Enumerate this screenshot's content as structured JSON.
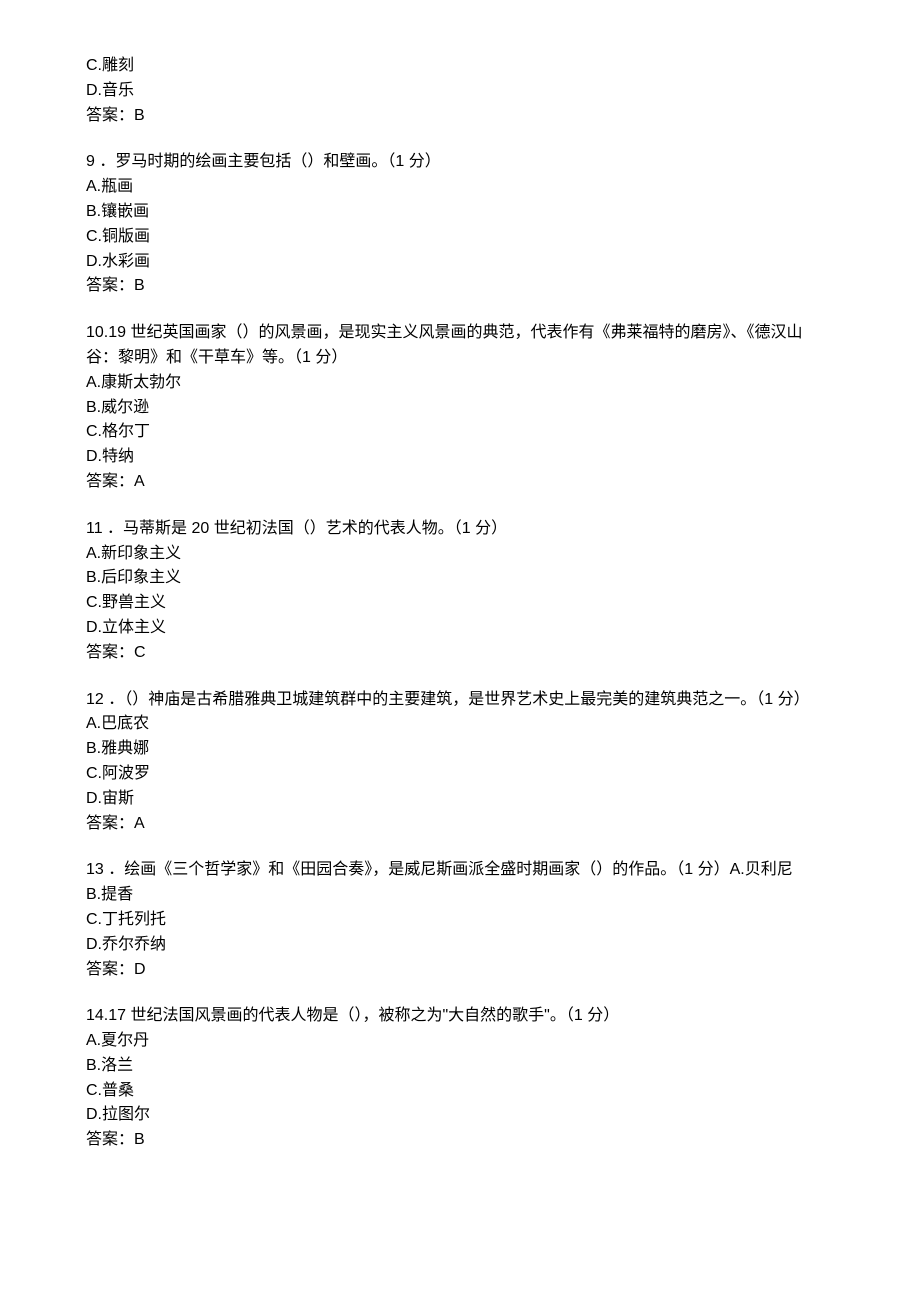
{
  "questions": [
    {
      "stem": "",
      "optC": "C.雕刻",
      "optD": "D.音乐",
      "answer": "答案：B"
    },
    {
      "stem": "9 ．罗马时期的绘画主要包括（）和壁画。（1 分）",
      "optA": "A.瓶画",
      "optB": "B.镶嵌画",
      "optC": "C.铜版画",
      "optD": "D.水彩画",
      "answer": "答案：B"
    },
    {
      "stem": "10.19 世纪英国画家（）的风景画，是现实主义风景画的典范，代表作有《弗莱福特的磨房》、《德汉山谷：黎明》和《干草车》等。（1 分）",
      "optA": "A.康斯太勃尔",
      "optB": "B.威尔逊",
      "optC": "C.格尔丁",
      "optD": "D.特纳",
      "answer": "答案：A"
    },
    {
      "stem": "11 ．马蒂斯是 20 世纪初法国（）艺术的代表人物。（1 分）",
      "optA": "A.新印象主义",
      "optB": "B.后印象主义",
      "optC": "C.野兽主义",
      "optD": "D.立体主义",
      "answer": "答案：C"
    },
    {
      "stem": "12 ．（）神庙是古希腊雅典卫城建筑群中的主要建筑，是世界艺术史上最完美的建筑典范之一。（1 分）",
      "optA": "A.巴底农",
      "optB": "B.雅典娜",
      "optC": "C.阿波罗",
      "optD": "D.宙斯",
      "answer": "答案：A"
    },
    {
      "stem": "13 ．绘画《三个哲学家》和《田园合奏》，是威尼斯画派全盛时期画家（）的作品。（1 分）A.贝利尼",
      "optB": "B.提香",
      "optC": "C.丁托列托",
      "optD": "D.乔尔乔纳",
      "answer": "答案：D"
    },
    {
      "stem": "14.17 世纪法国风景画的代表人物是（），被称之为\"大自然的歌手\"。（1 分）",
      "optA": "A.夏尔丹",
      "optB": "B.洛兰",
      "optC": "C.普桑",
      "optD": "D.拉图尔",
      "answer": "答案：B"
    }
  ]
}
